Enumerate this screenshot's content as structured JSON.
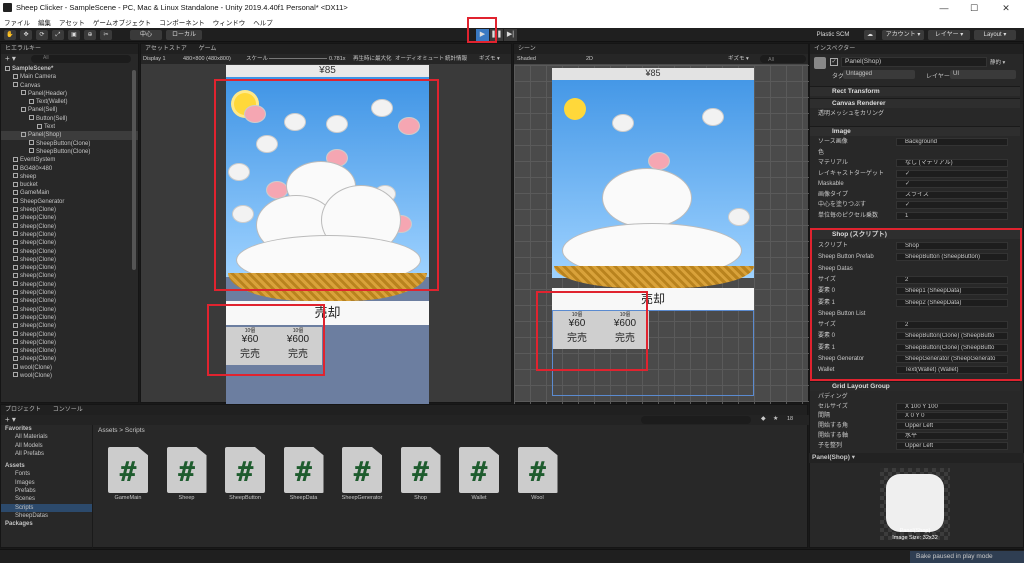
{
  "window": {
    "title": "Sheep Clicker - SampleScene - PC, Mac & Linux Standalone - Unity 2019.4.40f1 Personal* <DX11>",
    "minimize": "—",
    "maximize": "☐",
    "close": "✕"
  },
  "menu": [
    "ファイル",
    "編集",
    "アセット",
    "ゲームオブジェクト",
    "コンポーネント",
    "ウィンドウ",
    "ヘルプ"
  ],
  "toolbar": {
    "pivot": "中心",
    "space": "ローカル",
    "play_icon": "▶",
    "pause_icon": "❚❚",
    "step_icon": "▶|",
    "plastic": "Plastic SCM",
    "account": "アカウント ▾",
    "layers": "レイヤー ▾",
    "layout": "Layout ▾"
  },
  "hierarchy": {
    "tab": "ヒエラルキー",
    "search_placeholder": "All",
    "items": [
      {
        "label": "SampleScene*",
        "depth": 0
      },
      {
        "label": "Main Camera",
        "depth": 1
      },
      {
        "label": "Canvas",
        "depth": 1
      },
      {
        "label": "Panel(Header)",
        "depth": 2
      },
      {
        "label": "Text(Wallet)",
        "depth": 3
      },
      {
        "label": "Panel(Sell)",
        "depth": 2
      },
      {
        "label": "Button(Sell)",
        "depth": 3
      },
      {
        "label": "Text",
        "depth": 4
      },
      {
        "label": "Panel(Shop)",
        "depth": 2
      },
      {
        "label": "SheepButton(Clone)",
        "depth": 3
      },
      {
        "label": "SheepButton(Clone)",
        "depth": 3
      },
      {
        "label": "EventSystem",
        "depth": 1
      },
      {
        "label": "BG480×480",
        "depth": 1
      },
      {
        "label": "sheep",
        "depth": 1
      },
      {
        "label": "bucket",
        "depth": 1
      },
      {
        "label": "GameMain",
        "depth": 1
      },
      {
        "label": "SheepGenerator",
        "depth": 1
      },
      {
        "label": "sheep(Clone)",
        "depth": 1
      },
      {
        "label": "sheep(Clone)",
        "depth": 1
      },
      {
        "label": "sheep(Clone)",
        "depth": 1
      },
      {
        "label": "sheep(Clone)",
        "depth": 1
      },
      {
        "label": "sheep(Clone)",
        "depth": 1
      },
      {
        "label": "sheep(Clone)",
        "depth": 1
      },
      {
        "label": "sheep(Clone)",
        "depth": 1
      },
      {
        "label": "sheep(Clone)",
        "depth": 1
      },
      {
        "label": "sheep(Clone)",
        "depth": 1
      },
      {
        "label": "sheep(Clone)",
        "depth": 1
      },
      {
        "label": "sheep(Clone)",
        "depth": 1
      },
      {
        "label": "sheep(Clone)",
        "depth": 1
      },
      {
        "label": "sheep(Clone)",
        "depth": 1
      },
      {
        "label": "sheep(Clone)",
        "depth": 1
      },
      {
        "label": "sheep(Clone)",
        "depth": 1
      },
      {
        "label": "sheep(Clone)",
        "depth": 1
      },
      {
        "label": "sheep(Clone)",
        "depth": 1
      },
      {
        "label": "sheep(Clone)",
        "depth": 1
      },
      {
        "label": "sheep(Clone)",
        "depth": 1
      },
      {
        "label": "wool(Clone)",
        "depth": 1
      },
      {
        "label": "wool(Clone)",
        "depth": 1
      }
    ]
  },
  "game_view": {
    "tabs": [
      "アセットストア",
      "ゲーム"
    ],
    "display": "Display 1",
    "resolution": "480×800 (480x800)",
    "scale_label": "スケール",
    "scale_value": "0.781x",
    "options": [
      "再生時に最大化",
      "オーディオミュート",
      "統計情報",
      "ギズモ ▾"
    ],
    "wallet": "¥85",
    "sell": "売却",
    "shop": [
      {
        "top": "10個",
        "price": "¥60",
        "sell": "完売"
      },
      {
        "top": "10個",
        "price": "¥600",
        "sell": "完売"
      }
    ]
  },
  "scene_view": {
    "tab": "シーン",
    "shading": "Shaded",
    "mode": "2D",
    "gizmo": "ギズモ ▾",
    "search_placeholder": "All",
    "wallet": "¥85",
    "sell": "売却"
  },
  "inspector": {
    "tab": "インスペクター",
    "object_name": "Panel(Shop)",
    "static": "静的 ▾",
    "tag_label": "タグ",
    "tag_value": "Untagged",
    "layer_label": "レイヤー",
    "layer_value": "UI",
    "components": [
      "Rect Transform",
      "Canvas Renderer",
      "Image"
    ],
    "cull_label": "透明メッシュをカリング",
    "image": [
      {
        "label": "ソース画像",
        "value": "Background"
      },
      {
        "label": "色",
        "value": ""
      },
      {
        "label": "マテリアル",
        "value": "なし (マテリアル)"
      },
      {
        "label": "レイキャストターゲット",
        "value": "✓"
      },
      {
        "label": "Maskable",
        "value": "✓"
      },
      {
        "label": "画像タイプ",
        "value": "スライス"
      },
      {
        "label": "中心を塗りつぶす",
        "value": "✓"
      },
      {
        "label": "単位毎のピクセル乗数",
        "value": "1"
      }
    ],
    "shop_header": "Shop (スクリプト)",
    "shop_fields": [
      {
        "label": "スクリプト",
        "value": "Shop"
      },
      {
        "label": "Sheep Button Prefab",
        "value": "SheepButton (SheepButton)"
      },
      {
        "label": "Sheep Datas",
        "value": ""
      },
      {
        "label": "サイズ",
        "value": "2"
      },
      {
        "label": "要素 0",
        "value": "Sheep1 (SheepData)"
      },
      {
        "label": "要素 1",
        "value": "Sheep2 (SheepData)"
      },
      {
        "label": "Sheep Button List",
        "value": ""
      },
      {
        "label": "サイズ",
        "value": "2"
      },
      {
        "label": "要素 0",
        "value": "SheepButton(Clone) (SheepButto"
      },
      {
        "label": "要素 1",
        "value": "SheepButton(Clone) (SheepButto"
      },
      {
        "label": "Sheep Generator",
        "value": "SheepGenerator (SheepGenerato"
      },
      {
        "label": "Wallet",
        "value": "Text(Wallet) (Wallet)"
      }
    ],
    "grid_header": "Grid Layout Group",
    "grid": [
      {
        "label": "パディング",
        "value": ""
      },
      {
        "label": "セルサイズ",
        "value": "X 100    Y 100"
      },
      {
        "label": "間隔",
        "value": "X 0      Y 0"
      },
      {
        "label": "開始する角",
        "value": "Upper Left"
      },
      {
        "label": "開始する軸",
        "value": "水平"
      },
      {
        "label": "子を整列",
        "value": "Upper Left"
      }
    ],
    "preview_title": "Panel(Shop) ▾",
    "preview_name": "Panel(Shop)",
    "preview_size": "Image Size: 32x32"
  },
  "project": {
    "tabs": [
      "プロジェクト",
      "コンソール"
    ],
    "favorites": "Favorites",
    "fav_items": [
      "All Materials",
      "All Models",
      "All Prefabs"
    ],
    "assets": "Assets",
    "folders": [
      "Fonts",
      "Images",
      "Prefabs",
      "Scenes",
      "Scripts",
      "SheepDatas"
    ],
    "packages": "Packages",
    "breadcrumb": "Assets > Scripts",
    "count": "18",
    "scripts": [
      "GameMain",
      "Sheep",
      "SheepButton",
      "SheepData",
      "SheepGenerator",
      "Shop",
      "Wallet",
      "Wool"
    ]
  },
  "status": "Bake paused in play mode",
  "colors": {
    "highlight": "#e0232f",
    "sky": "#4a9be8",
    "script_icon": "#1e5c2e"
  }
}
